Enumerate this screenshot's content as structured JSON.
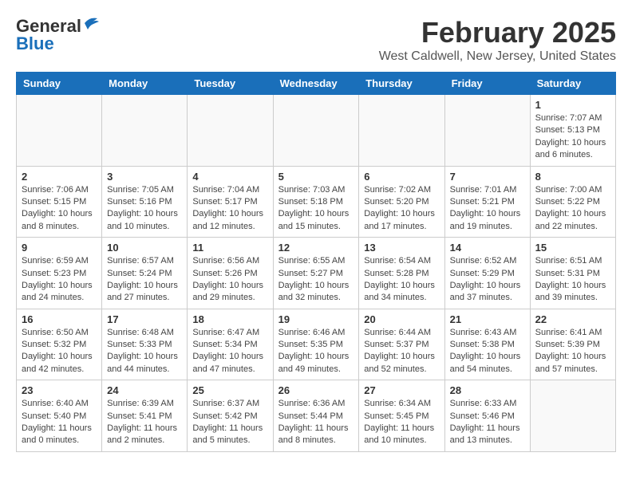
{
  "header": {
    "logo_general": "General",
    "logo_blue": "Blue",
    "main_title": "February 2025",
    "subtitle": "West Caldwell, New Jersey, United States"
  },
  "calendar": {
    "days_of_week": [
      "Sunday",
      "Monday",
      "Tuesday",
      "Wednesday",
      "Thursday",
      "Friday",
      "Saturday"
    ],
    "weeks": [
      [
        {
          "day": "",
          "info": ""
        },
        {
          "day": "",
          "info": ""
        },
        {
          "day": "",
          "info": ""
        },
        {
          "day": "",
          "info": ""
        },
        {
          "day": "",
          "info": ""
        },
        {
          "day": "",
          "info": ""
        },
        {
          "day": "1",
          "info": "Sunrise: 7:07 AM\nSunset: 5:13 PM\nDaylight: 10 hours and 6 minutes."
        }
      ],
      [
        {
          "day": "2",
          "info": "Sunrise: 7:06 AM\nSunset: 5:15 PM\nDaylight: 10 hours and 8 minutes."
        },
        {
          "day": "3",
          "info": "Sunrise: 7:05 AM\nSunset: 5:16 PM\nDaylight: 10 hours and 10 minutes."
        },
        {
          "day": "4",
          "info": "Sunrise: 7:04 AM\nSunset: 5:17 PM\nDaylight: 10 hours and 12 minutes."
        },
        {
          "day": "5",
          "info": "Sunrise: 7:03 AM\nSunset: 5:18 PM\nDaylight: 10 hours and 15 minutes."
        },
        {
          "day": "6",
          "info": "Sunrise: 7:02 AM\nSunset: 5:20 PM\nDaylight: 10 hours and 17 minutes."
        },
        {
          "day": "7",
          "info": "Sunrise: 7:01 AM\nSunset: 5:21 PM\nDaylight: 10 hours and 19 minutes."
        },
        {
          "day": "8",
          "info": "Sunrise: 7:00 AM\nSunset: 5:22 PM\nDaylight: 10 hours and 22 minutes."
        }
      ],
      [
        {
          "day": "9",
          "info": "Sunrise: 6:59 AM\nSunset: 5:23 PM\nDaylight: 10 hours and 24 minutes."
        },
        {
          "day": "10",
          "info": "Sunrise: 6:57 AM\nSunset: 5:24 PM\nDaylight: 10 hours and 27 minutes."
        },
        {
          "day": "11",
          "info": "Sunrise: 6:56 AM\nSunset: 5:26 PM\nDaylight: 10 hours and 29 minutes."
        },
        {
          "day": "12",
          "info": "Sunrise: 6:55 AM\nSunset: 5:27 PM\nDaylight: 10 hours and 32 minutes."
        },
        {
          "day": "13",
          "info": "Sunrise: 6:54 AM\nSunset: 5:28 PM\nDaylight: 10 hours and 34 minutes."
        },
        {
          "day": "14",
          "info": "Sunrise: 6:52 AM\nSunset: 5:29 PM\nDaylight: 10 hours and 37 minutes."
        },
        {
          "day": "15",
          "info": "Sunrise: 6:51 AM\nSunset: 5:31 PM\nDaylight: 10 hours and 39 minutes."
        }
      ],
      [
        {
          "day": "16",
          "info": "Sunrise: 6:50 AM\nSunset: 5:32 PM\nDaylight: 10 hours and 42 minutes."
        },
        {
          "day": "17",
          "info": "Sunrise: 6:48 AM\nSunset: 5:33 PM\nDaylight: 10 hours and 44 minutes."
        },
        {
          "day": "18",
          "info": "Sunrise: 6:47 AM\nSunset: 5:34 PM\nDaylight: 10 hours and 47 minutes."
        },
        {
          "day": "19",
          "info": "Sunrise: 6:46 AM\nSunset: 5:35 PM\nDaylight: 10 hours and 49 minutes."
        },
        {
          "day": "20",
          "info": "Sunrise: 6:44 AM\nSunset: 5:37 PM\nDaylight: 10 hours and 52 minutes."
        },
        {
          "day": "21",
          "info": "Sunrise: 6:43 AM\nSunset: 5:38 PM\nDaylight: 10 hours and 54 minutes."
        },
        {
          "day": "22",
          "info": "Sunrise: 6:41 AM\nSunset: 5:39 PM\nDaylight: 10 hours and 57 minutes."
        }
      ],
      [
        {
          "day": "23",
          "info": "Sunrise: 6:40 AM\nSunset: 5:40 PM\nDaylight: 11 hours and 0 minutes."
        },
        {
          "day": "24",
          "info": "Sunrise: 6:39 AM\nSunset: 5:41 PM\nDaylight: 11 hours and 2 minutes."
        },
        {
          "day": "25",
          "info": "Sunrise: 6:37 AM\nSunset: 5:42 PM\nDaylight: 11 hours and 5 minutes."
        },
        {
          "day": "26",
          "info": "Sunrise: 6:36 AM\nSunset: 5:44 PM\nDaylight: 11 hours and 8 minutes."
        },
        {
          "day": "27",
          "info": "Sunrise: 6:34 AM\nSunset: 5:45 PM\nDaylight: 11 hours and 10 minutes."
        },
        {
          "day": "28",
          "info": "Sunrise: 6:33 AM\nSunset: 5:46 PM\nDaylight: 11 hours and 13 minutes."
        },
        {
          "day": "",
          "info": ""
        }
      ]
    ]
  }
}
